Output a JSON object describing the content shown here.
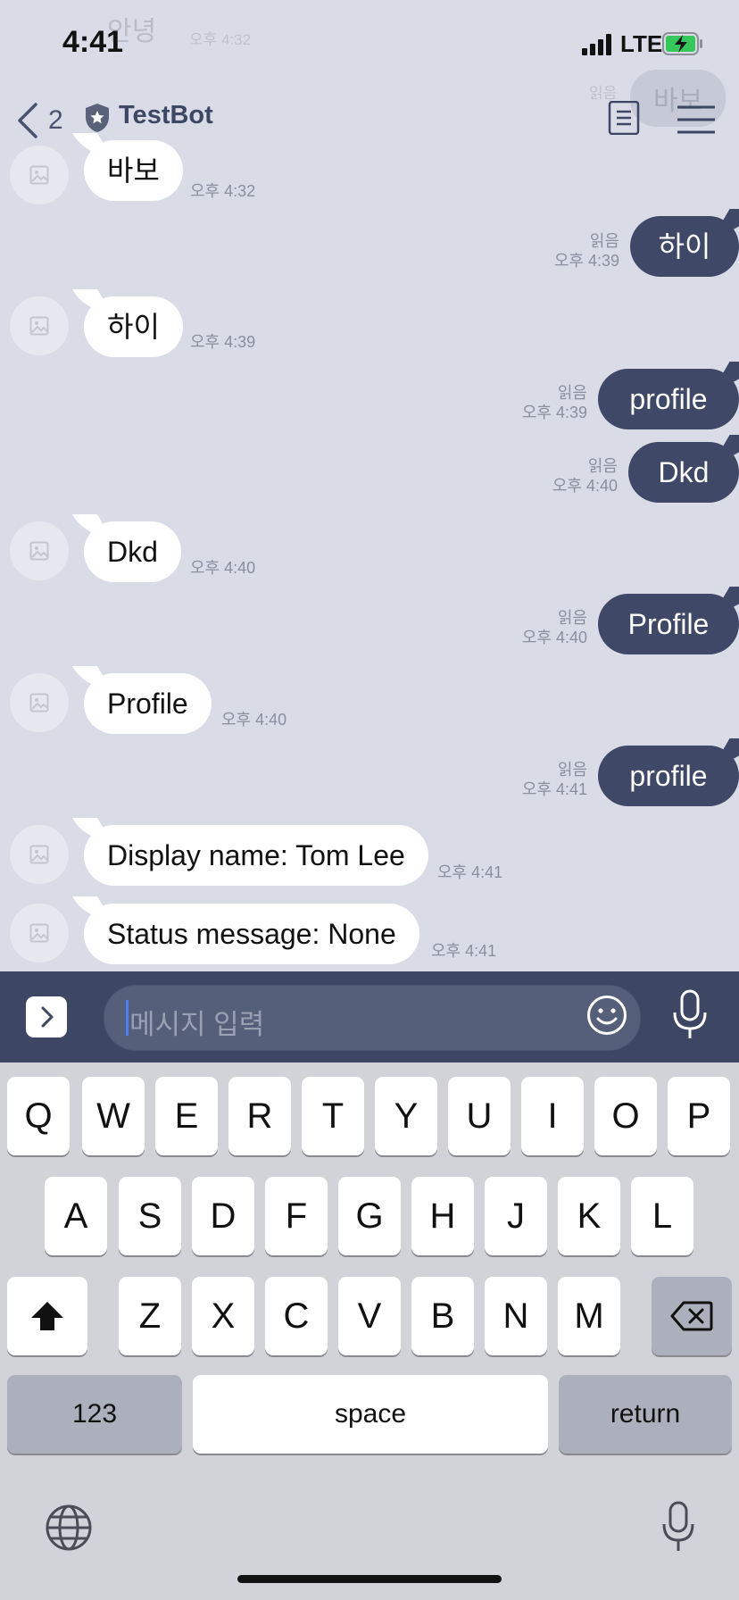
{
  "status_bar": {
    "time": "4:41",
    "network": "LTE"
  },
  "ghost_messages": {
    "incoming_text": "안녕",
    "incoming_time": "오후 4:32",
    "outgoing_text": "바보",
    "outgoing_read": "읽음"
  },
  "header": {
    "unread_count": "2",
    "title": "TestBot"
  },
  "messages": [
    {
      "dir": "in",
      "text": "바보",
      "time": "오후 4:32"
    },
    {
      "dir": "out",
      "text": "하이",
      "read": "읽음",
      "time": "오후 4:39"
    },
    {
      "dir": "in",
      "text": "하이",
      "time": "오후 4:39"
    },
    {
      "dir": "out",
      "text": "profile",
      "read": "읽음",
      "time": "오후 4:39"
    },
    {
      "dir": "out",
      "text": "Dkd",
      "read": "읽음",
      "time": "오후 4:40"
    },
    {
      "dir": "in",
      "text": "Dkd",
      "time": "오후 4:40"
    },
    {
      "dir": "out",
      "text": "Profile",
      "read": "읽음",
      "time": "오후 4:40"
    },
    {
      "dir": "in",
      "text": "Profile",
      "time": "오후 4:40"
    },
    {
      "dir": "out",
      "text": "profile",
      "read": "읽음",
      "time": "오후 4:41"
    },
    {
      "dir": "in",
      "text": "Display name: Tom Lee",
      "time": "오후 4:41"
    },
    {
      "dir": "in",
      "text": "Status message: None",
      "time": "오후 4:41"
    }
  ],
  "input": {
    "placeholder": "메시지 입력"
  },
  "keyboard": {
    "row1": [
      "Q",
      "W",
      "E",
      "R",
      "T",
      "Y",
      "U",
      "I",
      "O",
      "P"
    ],
    "row2": [
      "A",
      "S",
      "D",
      "F",
      "G",
      "H",
      "J",
      "K",
      "L"
    ],
    "row3": [
      "Z",
      "X",
      "C",
      "V",
      "B",
      "N",
      "M"
    ],
    "numbers_label": "123",
    "space_label": "space",
    "return_label": "return"
  },
  "colors": {
    "chat_background": "#d9dce6",
    "outgoing_bubble": "#3f4866",
    "incoming_bubble": "#ffffff",
    "input_bar": "#3d4663"
  }
}
